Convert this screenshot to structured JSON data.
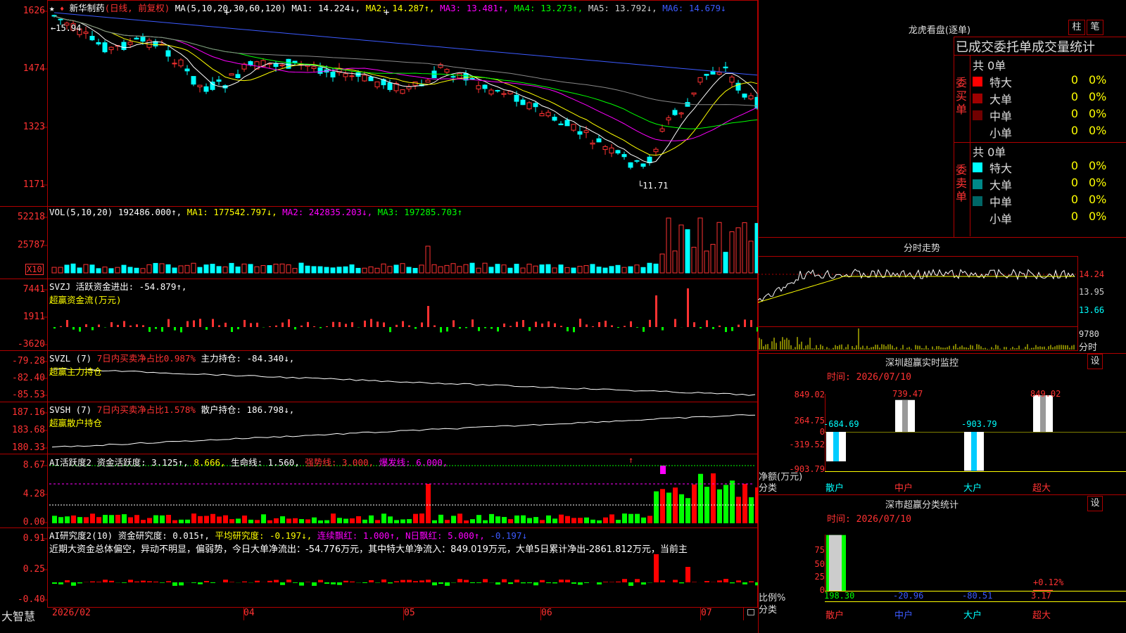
{
  "colors": {
    "up": "#ff3232",
    "down": "#00ffff",
    "ma1": "#ffffff",
    "ma2": "#ffff00",
    "ma3": "#ff00ff",
    "ma4": "#00ff00",
    "ma5": "#888888",
    "ma6": "#3c5aff",
    "grid": "#b00000"
  },
  "main": {
    "star": "★",
    "stock": "新华制药",
    "period": "(日线, 前复权)",
    "ma_params": "MA(5,10,20,30,60,120)",
    "ma1": "MA1: 14.224↓,",
    "ma2": "MA2: 14.287↑,",
    "ma3": "MA3: 13.481↑,",
    "ma4": "MA4: 13.273↑,",
    "ma5": "MA5: 13.792↓,",
    "ma6": "MA6: 14.679↓",
    "y_labels": [
      "1626",
      "1474",
      "1323",
      "1171"
    ],
    "high_note": "15.94",
    "low_note": "11.71"
  },
  "vol": {
    "params": "VOL(5,10,20)",
    "value": "192486.000↑,",
    "ma1": "MA1: 177542.797↓,",
    "ma2": "MA2: 242835.203↓,",
    "ma3": "MA3: 197285.703↑",
    "y_labels": [
      "52218",
      "25787"
    ],
    "unit": "X10"
  },
  "svzj": {
    "label1": "SVZJ  活跃资金进出: -54.879↑,",
    "label2": "超赢资金流(万元)",
    "y_labels": [
      "7441",
      "1911",
      "-3620"
    ]
  },
  "svzl": {
    "label_name": "SVZL (7)",
    "label_b": "7日内买卖净占比0.987%",
    "label_c": "主力持仓: -84.340↓,",
    "label2": "超赢主力持仓",
    "y_labels": [
      "-79.28",
      "-82.40",
      "-85.53"
    ]
  },
  "svsh": {
    "label_name": "SVSH (7)",
    "label_b": "7日内买卖净占比1.578%",
    "label_c": "散户持仓: 186.798↓,",
    "label2": "超赢散户持仓",
    "y_labels": [
      "187.16",
      "183.68",
      "180.33"
    ]
  },
  "ai1": {
    "label_a": "AI活跃度2 资金活跃度: 3.125↑,",
    "label_b": "8.666,",
    "label_c": "生命线: 1.560,",
    "label_d": "强势线: 3.000,",
    "label_e": "爆发线: 6.000,",
    "y_labels": [
      "8.67",
      "4.28",
      "0.00"
    ]
  },
  "ai2": {
    "label_a": "AI研究度2(10) 资金研究度: 0.015↑,",
    "label_b": "平均研究度: -0.197↓,",
    "label_c": "连续飘红: 1.000↑,",
    "label_d": "N日飘红: 5.000↑,",
    "label_e": "-0.197↓",
    "summary": "近期大资金总体偏空，异动不明显，偏弱势，今日大单净流出：-54.776万元，其中特大单净流入：849.019万元，大单5日累计净出-2861.812万元，当前主",
    "y_labels": [
      "0.91",
      "0.25",
      "-0.40"
    ]
  },
  "xaxis": {
    "labels": [
      "2026/02",
      "04",
      "05",
      "06",
      "07"
    ],
    "brand": "大智慧"
  },
  "right": {
    "lhkp_title": "龙虎看盘(逐单)",
    "btn_zhu": "柱",
    "btn_bi": "笔",
    "lhkp_header": "已成交委托单成交量统计",
    "buy_label": "委买单",
    "sell_label": "委卖单",
    "buy_total": "共 0单",
    "sell_total": "共 0单",
    "rows": [
      {
        "name": "特大",
        "v": "0",
        "p": "0%"
      },
      {
        "name": "大单",
        "v": "0",
        "p": "0%"
      },
      {
        "name": "中单",
        "v": "0",
        "p": "0%"
      },
      {
        "name": "小单",
        "v": "0",
        "p": "0%"
      }
    ],
    "fs_title": "分时走势",
    "fs_labels": [
      "14.24",
      "13.95",
      "13.66",
      "9780",
      "分时"
    ],
    "sz_title": "深圳超赢实时监控",
    "sz_time": "时间: 2026/07/10",
    "sz_set": "设",
    "sz_ylabels": [
      "849.02",
      "264.75",
      "0",
      "-319.52",
      "-903.79"
    ],
    "sz_values": [
      {
        "name": "散户",
        "v": "-684.69"
      },
      {
        "name": "中户",
        "v": "739.47"
      },
      {
        "name": "大户",
        "v": "-903.79"
      },
      {
        "name": "超大",
        "v": "849.02"
      }
    ],
    "sz_unit1": "净额(万元)",
    "sz_unit2": "分类",
    "ss_title": "深市超赢分类统计",
    "ss_time": "时间: 2026/07/10",
    "ss_set": "设",
    "ss_ylabels": [
      "75",
      "50",
      "25",
      "0"
    ],
    "ss_values": [
      {
        "name": "散户",
        "v": "198.30"
      },
      {
        "name": "中户",
        "v": "-20.96"
      },
      {
        "name": "大户",
        "v": "-80.51"
      },
      {
        "name": "超大",
        "v": "3.17"
      }
    ],
    "ss_extra": "+0.12%",
    "ss_unit1": "比例%",
    "ss_unit2": "分类"
  }
}
